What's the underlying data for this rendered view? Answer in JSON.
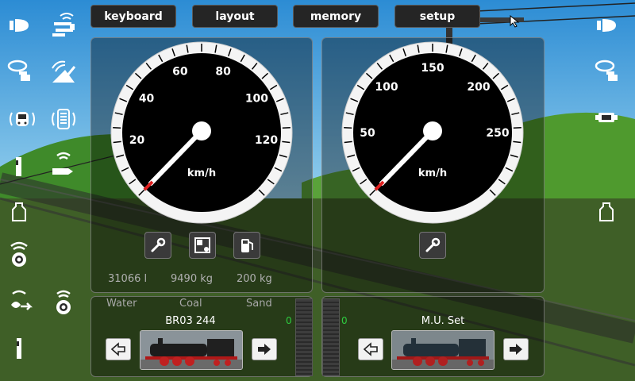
{
  "menu": {
    "keyboard": "keyboard",
    "layout": "layout",
    "memory": "memory",
    "setup": "setup"
  },
  "left_icons": [
    "headlight-icon",
    "crane-icon",
    "whistle-icon",
    "fan-icon",
    "cab-sound-icon",
    "radio-icon",
    "coupler-icon",
    "steam-icon",
    "weight-icon",
    "sound-icon",
    "driver-icon",
    "hazard-icon",
    "door-icon"
  ],
  "right_icons": [
    "headlight-icon",
    "whistle-icon",
    "coupling-icon",
    "weight-icon"
  ],
  "gauge1": {
    "unit": "km/h",
    "ticks": [
      "20",
      "40",
      "60",
      "80",
      "100",
      "120"
    ],
    "speed": 0
  },
  "gauge2": {
    "unit": "km/h",
    "ticks": [
      "50",
      "100",
      "150",
      "200",
      "250"
    ],
    "speed": 0
  },
  "consumables": {
    "water_value": "31066 l",
    "coal_value": "9490 kg",
    "sand_value": "200 kg",
    "water_label": "Water",
    "coal_label": "Coal",
    "sand_label": "Sand"
  },
  "loco1": {
    "name": "BR03 244",
    "counter": "0"
  },
  "loco2": {
    "name": "M.U. Set",
    "counter": "0"
  },
  "colors": {
    "button_bg": "#252525",
    "gauge_face": "#000000",
    "gauge_ring": "#f4f4f4",
    "needle_tip": "#e02020",
    "counter_green": "#2ecc40"
  }
}
